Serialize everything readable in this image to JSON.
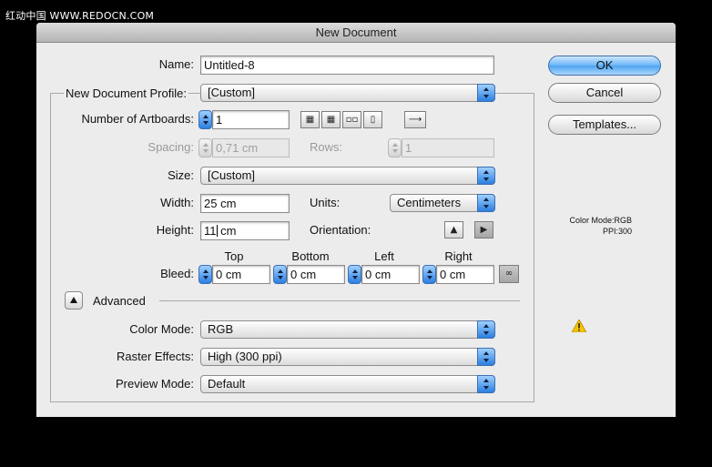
{
  "watermark": "红动中国 WWW.REDOCN.COM",
  "dialog": {
    "title": "New Document",
    "name": {
      "label": "Name:",
      "value": "Untitled-8"
    },
    "profile": {
      "label": "New Document Profile:",
      "value": "[Custom]"
    },
    "artboards": {
      "label": "Number of Artboards:",
      "value": "1",
      "layout_icons": [
        "grid-by-row-icon",
        "grid-by-column-icon",
        "arrange-by-row-icon",
        "arrange-by-column-icon"
      ],
      "direction_icon": "left-to-right-arrow-icon"
    },
    "spacing": {
      "label": "Spacing:",
      "value": "0,71 cm"
    },
    "rows": {
      "label": "Rows:",
      "value": "1"
    },
    "size": {
      "label": "Size:",
      "value": "[Custom]"
    },
    "width": {
      "label": "Width:",
      "value": "25 cm"
    },
    "units": {
      "label": "Units:",
      "value": "Centimeters"
    },
    "height": {
      "label": "Height:",
      "value_before_caret": "11",
      "value_after_caret": " cm"
    },
    "orientation": {
      "label": "Orientation:",
      "options": [
        "portrait-icon",
        "landscape-icon"
      ],
      "selected": "landscape"
    },
    "bleed": {
      "label": "Bleed:",
      "headers": {
        "top": "Top",
        "bottom": "Bottom",
        "left": "Left",
        "right": "Right"
      },
      "values": {
        "top": "0 cm",
        "bottom": "0 cm",
        "left": "0 cm",
        "right": "0 cm"
      },
      "link_icon": "chain-link-icon"
    },
    "advanced": {
      "label": "Advanced",
      "color_mode": {
        "label": "Color Mode:",
        "value": "RGB"
      },
      "raster_effects": {
        "label": "Raster Effects:",
        "value": "High (300 ppi)"
      },
      "preview_mode": {
        "label": "Preview Mode:",
        "value": "Default"
      }
    },
    "buttons": {
      "ok": "OK",
      "cancel": "Cancel",
      "templates": "Templates..."
    },
    "info": {
      "color_mode": "Color Mode:RGB",
      "ppi": "PPI:300"
    },
    "warning_icon": "warning-triangle-icon",
    "colors": {
      "accent": "#4ea3f0",
      "dialog_bg": "#ececec",
      "warning": "#f5c400"
    }
  }
}
